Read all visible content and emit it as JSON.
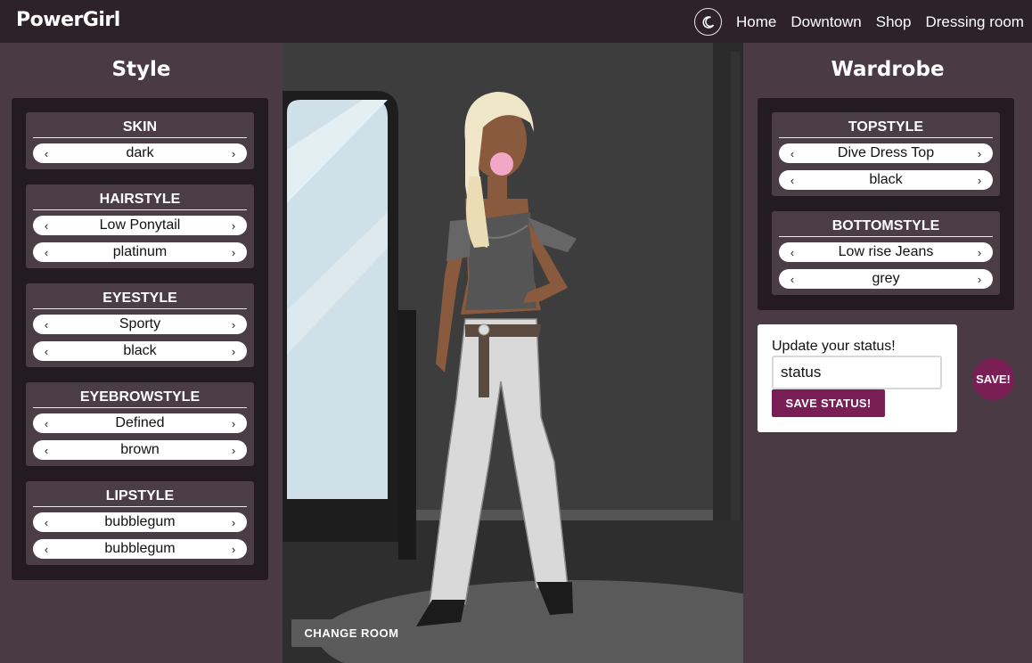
{
  "app": {
    "brand": "PowerGirl"
  },
  "nav": {
    "items": [
      "Home",
      "Downtown",
      "Shop",
      "Dressing room"
    ]
  },
  "style_panel": {
    "title": "Style",
    "groups": [
      {
        "title": "SKIN",
        "values": [
          "dark"
        ]
      },
      {
        "title": "HAIRSTYLE",
        "values": [
          "Low Ponytail",
          "platinum"
        ]
      },
      {
        "title": "EYESTYLE",
        "values": [
          "Sporty",
          "black"
        ]
      },
      {
        "title": "EYEBROWSTYLE",
        "values": [
          "Defined",
          "brown"
        ]
      },
      {
        "title": "LIPSTYLE",
        "values": [
          "bubblegum",
          "bubblegum"
        ]
      }
    ]
  },
  "wardrobe_panel": {
    "title": "Wardrobe",
    "groups": [
      {
        "title": "TOPSTYLE",
        "values": [
          "Dive Dress Top",
          "black"
        ]
      },
      {
        "title": "BOTTOMSTYLE",
        "values": [
          "Low rise Jeans",
          "grey"
        ]
      }
    ]
  },
  "status": {
    "label": "Update your status!",
    "value": "status",
    "button": "SAVE STATUS!"
  },
  "save_button": "SAVE!",
  "scene": {
    "change_room": "CHANGE ROOM"
  },
  "icons": {
    "theme_toggle": "moon-icon",
    "prev": "chevron-left-icon",
    "next": "chevron-right-icon"
  },
  "colors": {
    "accent": "#7a1f56",
    "panel": "#4a3a44",
    "nav": "#2d2227"
  }
}
